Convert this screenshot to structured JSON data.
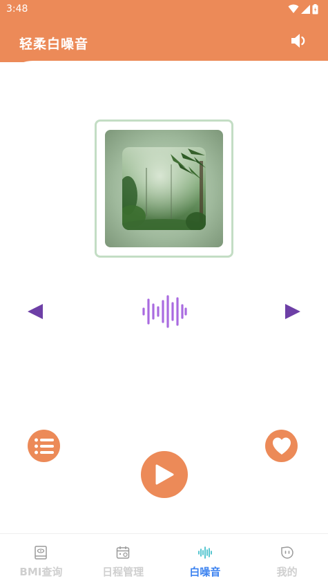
{
  "status_bar": {
    "time": "3:48",
    "icons": [
      "wifi-icon",
      "signal-icon",
      "battery-icon"
    ]
  },
  "header": {
    "title": "轻柔白噪音",
    "volume_icon": "volume-icon"
  },
  "player": {
    "cover_image": "bamboo-forest-rain",
    "prev_icon": "prev-triangle-icon",
    "next_icon": "next-triangle-icon",
    "waveform_icon": "sound-wave-icon",
    "playlist_icon": "list-icon",
    "favorite_icon": "heart-icon",
    "play_icon": "play-icon"
  },
  "bottom_nav": {
    "items": [
      {
        "label": "BMI查询",
        "icon": "bmi-book-icon",
        "active": false
      },
      {
        "label": "日程管理",
        "icon": "calendar-icon",
        "active": false
      },
      {
        "label": "白噪音",
        "icon": "sound-wave-icon",
        "active": true
      },
      {
        "label": "我的",
        "icon": "face-icon",
        "active": false
      }
    ]
  },
  "colors": {
    "accent": "#ec8a58",
    "purple": "#6d3fa6",
    "wave": "#a96be0",
    "nav_active": "#3b82f0",
    "nav_inactive": "#cfcfcf",
    "cover_border": "#c3ddc4"
  }
}
